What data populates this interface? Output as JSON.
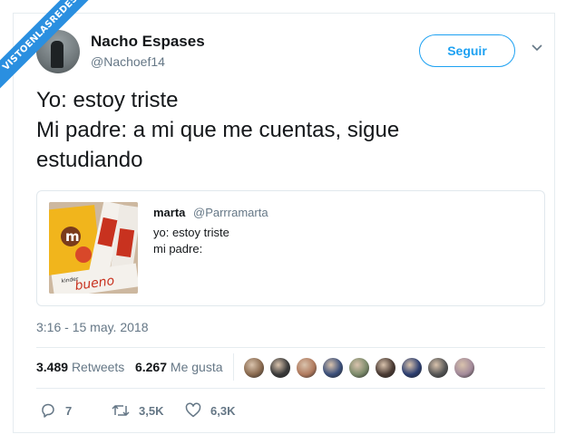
{
  "watermark": {
    "text": "VISTOENLASREDES"
  },
  "author": {
    "name": "Nacho Espases",
    "handle": "@Nachoef14"
  },
  "follow_button": {
    "label": "Seguir"
  },
  "tweet": {
    "lines": [
      "Yo: estoy triste",
      "Mi padre: a mi que me cuentas, sigue",
      "estudiando"
    ]
  },
  "quote": {
    "name": "marta",
    "handle": "@Parrramarta",
    "line1": "yo: estoy triste",
    "line2": "mi padre:",
    "image_text": {
      "brand_a": "m",
      "brand_b": "bueno",
      "brand_c": "kinder"
    }
  },
  "timestamp": "3:16 - 15 may. 2018",
  "stats": {
    "retweets_count": "3.489",
    "retweets_label": "Retweets",
    "likes_count": "6.267",
    "likes_label": "Me gusta"
  },
  "likers": [
    "#8a6a4f",
    "#3a3a3a",
    "#b07a5e",
    "#3b4f7a",
    "#7b8a6a",
    "#4a3a33",
    "#2c3e70",
    "#555555",
    "#a38a9a"
  ],
  "actions": {
    "replies": "7",
    "retweets": "3,5K",
    "likes": "6,3K"
  },
  "colors": {
    "accent": "#1da1f2",
    "muted": "#657786",
    "watermark": "#2a8fe0"
  }
}
